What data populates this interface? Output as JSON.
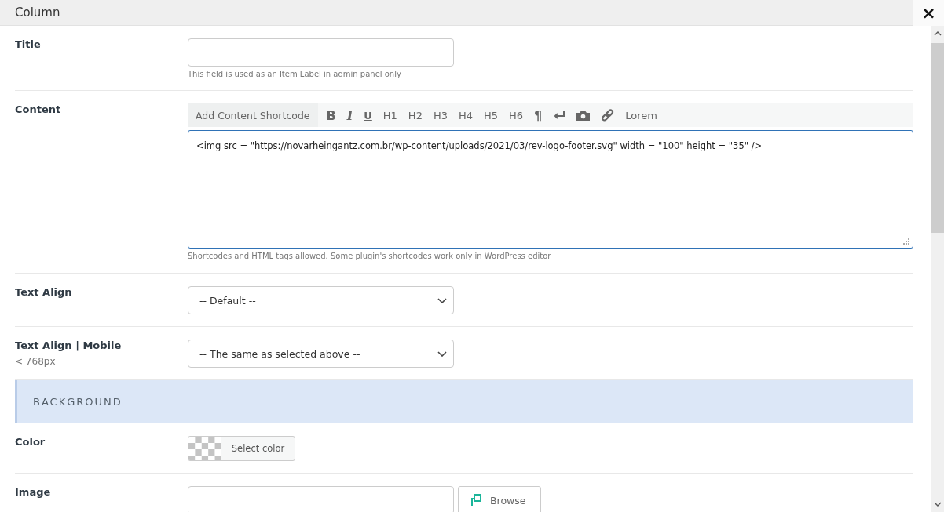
{
  "window": {
    "title": "Column",
    "close": "×"
  },
  "fields": [
    {
      "kind": "text",
      "label": "Title",
      "note": "This field is used as an Item Label in admin panel only"
    },
    {
      "kind": "editor",
      "label": "Content",
      "toolbar": [
        {
          "kind": "text",
          "label": "Add Content Shortcode"
        },
        {
          "kind": "bold",
          "label": "B"
        },
        {
          "kind": "italic",
          "label": "I"
        },
        {
          "kind": "underline",
          "label": "U"
        },
        {
          "kind": "plain",
          "label": "H1"
        },
        {
          "kind": "plain",
          "label": "H2"
        },
        {
          "kind": "plain",
          "label": "H3"
        },
        {
          "kind": "plain",
          "label": "H4"
        },
        {
          "kind": "plain",
          "label": "H5"
        },
        {
          "kind": "plain",
          "label": "H6"
        },
        {
          "kind": "bold",
          "label": "¶"
        },
        {
          "kind": "return"
        },
        {
          "kind": "camera"
        },
        {
          "kind": "link"
        },
        {
          "kind": "plain",
          "label": "Lorem"
        }
      ],
      "value": "<img src = \"https://novarheingantz.com.br/wp-content/uploads/2021/03/rev-logo-footer.svg\" width = \"100\" height = \"35\" />",
      "note": "Shortcodes and HTML tags allowed. Some plugin's shortcodes work only in WordPress editor"
    },
    {
      "kind": "select",
      "label": "Text Align",
      "value": "-- Default --"
    },
    {
      "kind": "select",
      "label": "Text Align | Mobile",
      "sublabel": "< 768px",
      "value": "-- The same as selected above --"
    },
    {
      "kind": "section",
      "label": "BACKGROUND"
    },
    {
      "kind": "color",
      "label": "Color",
      "button": "Select color"
    },
    {
      "kind": "image",
      "label": "Image",
      "button": "Browse"
    }
  ]
}
